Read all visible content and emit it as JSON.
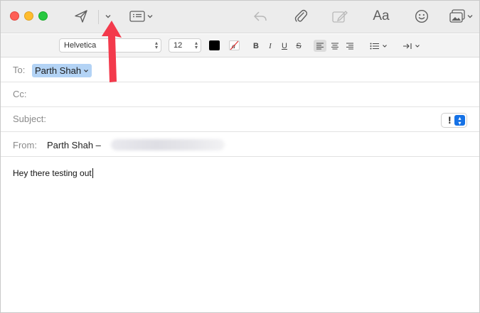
{
  "toolbar": {
    "buttons": [
      "send-icon",
      "send-options-chevron",
      "header-fields-icon",
      "reply-icon",
      "attach-icon",
      "markup-icon",
      "format-icon",
      "emoji-icon",
      "photo-browser-icon"
    ],
    "format_label": "Aa"
  },
  "formatbar": {
    "font": "Helvetica",
    "size": "12",
    "bold": "B",
    "italic": "I",
    "underline": "U",
    "strike": "S",
    "text_color": "#000000"
  },
  "headers": {
    "to_label": "To:",
    "to_recipient": "Parth Shah",
    "cc_label": "Cc:",
    "subject_label": "Subject:",
    "priority_symbol": "!",
    "from_label": "From:",
    "from_name": "Parth Shah –"
  },
  "message": {
    "body": "Hey there testing out"
  },
  "colors": {
    "annotation_arrow": "#f33a4c",
    "token_bg": "#b3d3f5",
    "accent": "#1672e6"
  }
}
